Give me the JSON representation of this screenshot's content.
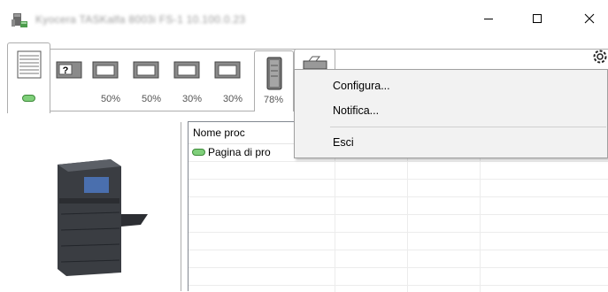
{
  "window": {
    "title": "Kyocera TASKalfa 8003i FS-1 10.100.0.23",
    "buttons": [
      "minimize",
      "maximize",
      "close"
    ]
  },
  "toolbar": {
    "tabs": [
      {
        "id": "paper",
        "icon": "paper-stack-icon",
        "active": true
      },
      {
        "id": "status",
        "icon": "toner-cartridge-icon",
        "active": false
      },
      {
        "id": "fax",
        "icon": "fax-icon",
        "active": false
      }
    ],
    "trays": [
      {
        "icon": "unknown-tray-icon",
        "level": ""
      },
      {
        "icon": "paper-tray-icon",
        "level": "50%"
      },
      {
        "icon": "paper-tray-icon",
        "level": "50%"
      },
      {
        "icon": "paper-tray-icon",
        "level": "30%"
      },
      {
        "icon": "paper-tray-icon",
        "level": "30%"
      }
    ],
    "toner_level": "78%",
    "settings_icon": "gear-icon"
  },
  "status_indicator_color": "#7fcf7a",
  "list": {
    "columns": [
      "Nome proc",
      "",
      "",
      ""
    ],
    "rows": [
      {
        "name": "Pagina di pro"
      }
    ]
  },
  "context_menu": {
    "items": [
      "Configura...",
      "Notifica...",
      "Esci"
    ]
  }
}
